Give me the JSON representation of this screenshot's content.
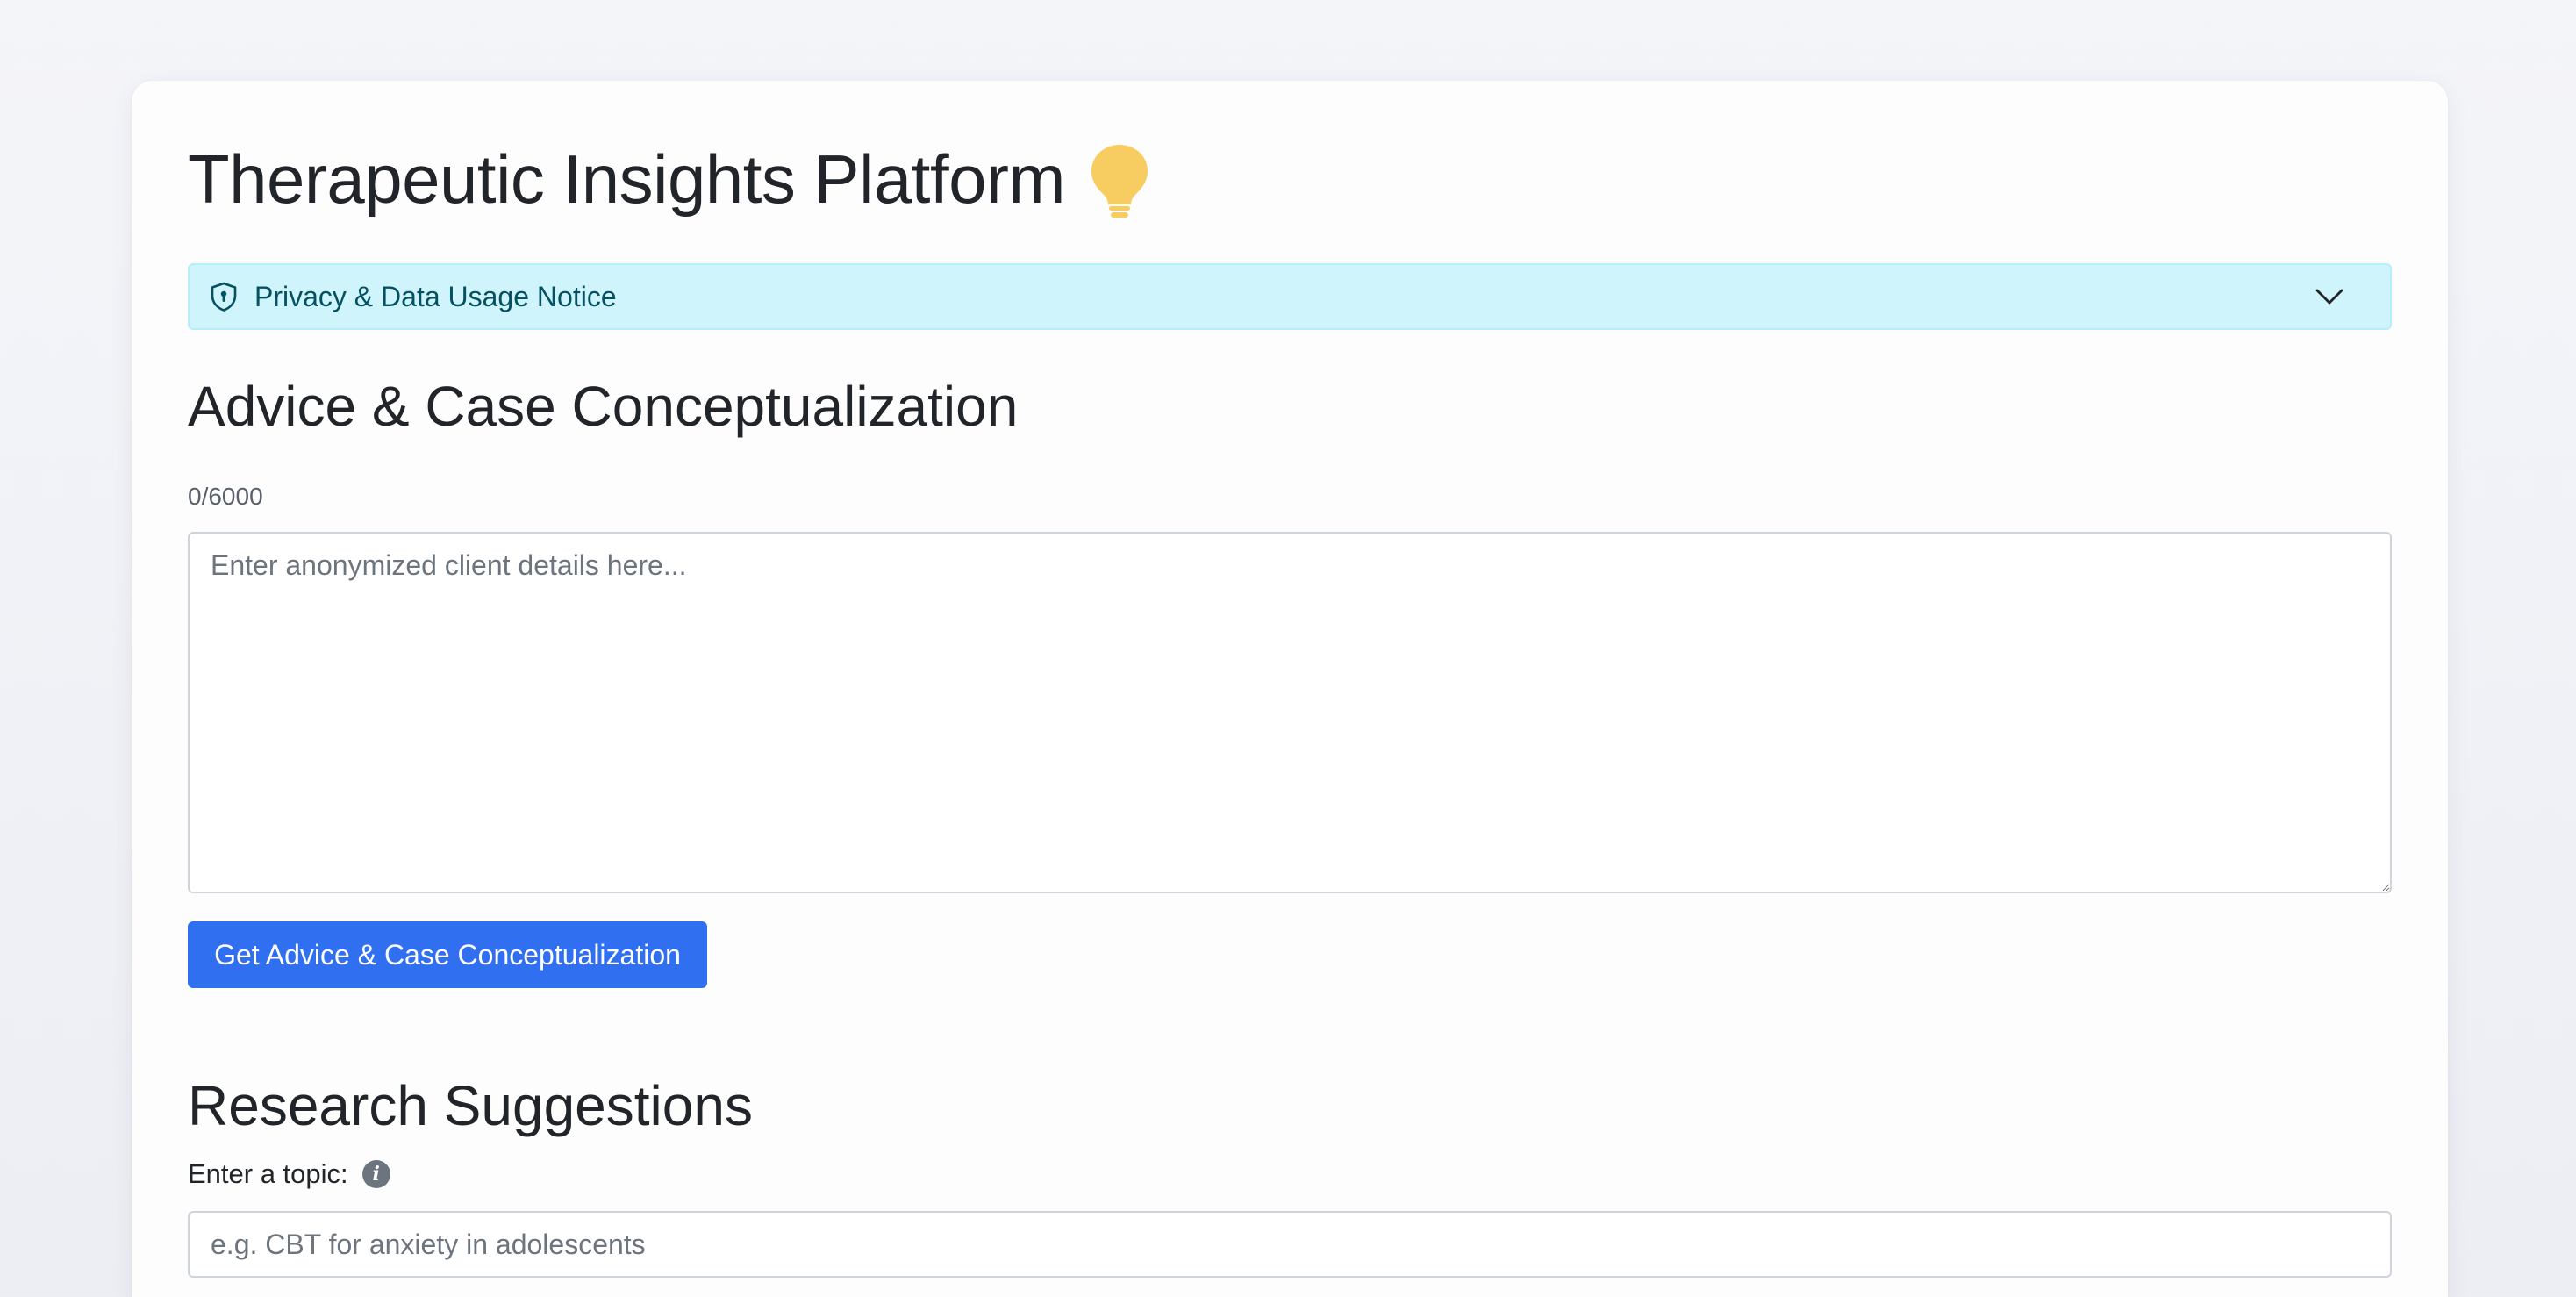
{
  "header": {
    "title": "Therapeutic Insights Platform"
  },
  "privacy_notice": {
    "label": "Privacy & Data Usage Notice",
    "expanded": false
  },
  "advice_section": {
    "heading": "Advice & Case Conceptualization",
    "char_counter": "0/6000",
    "textarea_placeholder": "Enter anonymized client details here...",
    "submit_label": "Get Advice & Case Conceptualization"
  },
  "research_section": {
    "heading": "Research Suggestions",
    "topic_label": "Enter a topic:",
    "topic_placeholder": "e.g. CBT for anxiety in adolescents"
  },
  "colors": {
    "primary": "#2f6ff0",
    "notice_bg": "#cff4fc",
    "notice_text": "#055160",
    "bulb": "#f7cd62"
  },
  "icons": {
    "title_icon": "lightbulb-icon",
    "notice_icon": "shield-icon",
    "notice_toggle": "chevron-down-icon",
    "topic_help": "info-icon"
  }
}
